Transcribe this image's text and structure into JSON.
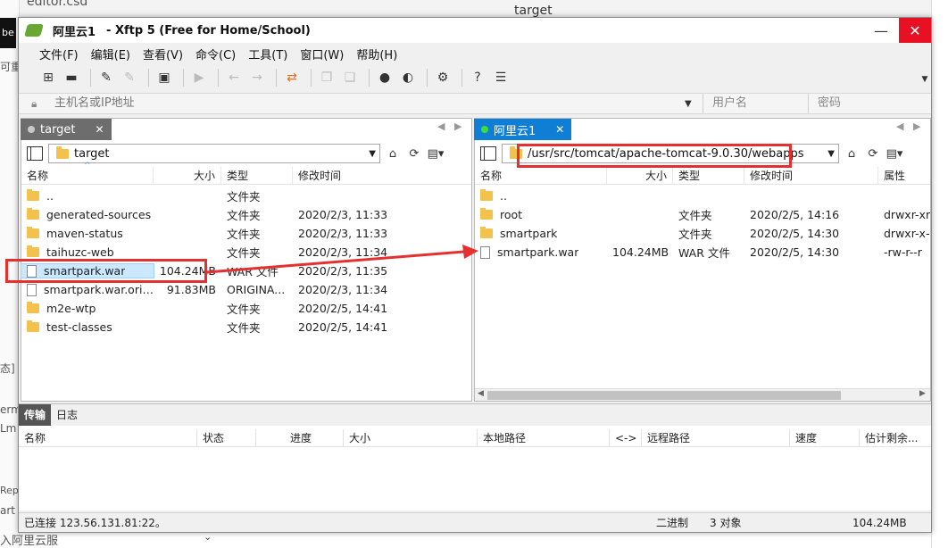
{
  "background": {
    "title_fragment": "editor.csd",
    "right_title": "target",
    "left_black": "be",
    "left_fragments": [
      "可重",
      "态]",
      "erm",
      "Lm"
    ],
    "bottom_fragments": [
      "Rep",
      "art",
      "入阿里云服"
    ]
  },
  "window": {
    "session_name": "阿里云1",
    "app_title": "- Xftp 5 (Free for Home/School)",
    "minimize": "—",
    "close": "✕"
  },
  "menu": [
    "文件(F)",
    "编辑(E)",
    "查看(V)",
    "命令(C)",
    "工具(T)",
    "窗口(W)",
    "帮助(H)"
  ],
  "address": {
    "placeholder": "主机名或IP地址",
    "user_placeholder": "用户名",
    "pass_placeholder": "密码"
  },
  "left_pane": {
    "tab": "target",
    "path": "target",
    "columns": [
      "名称",
      "大小",
      "类型",
      "修改时间"
    ],
    "rows": [
      {
        "name": "..",
        "size": "",
        "type": "文件夹",
        "mtime": "",
        "kind": "folder"
      },
      {
        "name": "generated-sources",
        "size": "",
        "type": "文件夹",
        "mtime": "2020/2/3, 11:33",
        "kind": "folder"
      },
      {
        "name": "maven-status",
        "size": "",
        "type": "文件夹",
        "mtime": "2020/2/3, 11:33",
        "kind": "folder"
      },
      {
        "name": "taihuzc-web",
        "size": "",
        "type": "文件夹",
        "mtime": "2020/2/3, 11:34",
        "kind": "folder"
      },
      {
        "name": "smartpark.war",
        "size": "104.24MB",
        "type": "WAR 文件",
        "mtime": "2020/2/3, 11:35",
        "kind": "file",
        "selected": true
      },
      {
        "name": "smartpark.war.original",
        "size": "91.83MB",
        "type": "ORIGINA...",
        "mtime": "2020/2/3, 11:34",
        "kind": "file"
      },
      {
        "name": "m2e-wtp",
        "size": "",
        "type": "文件夹",
        "mtime": "2020/2/5, 14:41",
        "kind": "folder"
      },
      {
        "name": "test-classes",
        "size": "",
        "type": "文件夹",
        "mtime": "2020/2/5, 14:41",
        "kind": "folder"
      }
    ]
  },
  "right_pane": {
    "tab": "阿里云1",
    "path": "/usr/src/tomcat/apache-tomcat-9.0.30/webapps",
    "columns": [
      "名称",
      "大小",
      "类型",
      "修改时间",
      "属性"
    ],
    "rows": [
      {
        "name": "..",
        "size": "",
        "type": "",
        "mtime": "",
        "attr": "",
        "kind": "folder"
      },
      {
        "name": "root",
        "size": "",
        "type": "文件夹",
        "mtime": "2020/2/5, 14:16",
        "attr": "drwxr-xr",
        "kind": "folder"
      },
      {
        "name": "smartpark",
        "size": "",
        "type": "文件夹",
        "mtime": "2020/2/5, 14:30",
        "attr": "drwxr-x-",
        "kind": "folder"
      },
      {
        "name": "smartpark.war",
        "size": "104.24MB",
        "type": "WAR 文件",
        "mtime": "2020/2/5, 14:30",
        "attr": "-rw-r--r",
        "kind": "file"
      }
    ]
  },
  "transfer": {
    "tabs": [
      "传输",
      "日志"
    ],
    "columns": [
      "名称",
      "状态",
      "进度",
      "大小",
      "本地路径",
      "<->",
      "远程路径",
      "速度",
      "估计剩余..."
    ]
  },
  "status": {
    "connection": "已连接 123.56.131.81:22。",
    "mode": "二进制",
    "count": "3 对象",
    "size": "104.24MB"
  },
  "colors": {
    "left_tab": "#6d6d6d",
    "right_tab": "#0f7fd6",
    "highlight": "#e53030",
    "close_button": "#e81123"
  }
}
